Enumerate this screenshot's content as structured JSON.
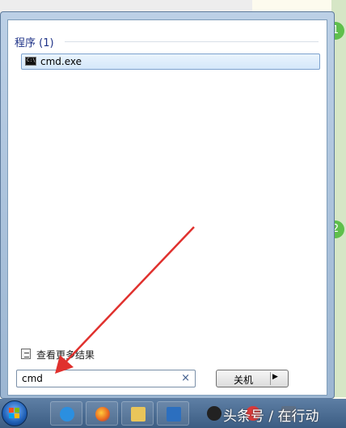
{
  "start_menu": {
    "group": {
      "title": "程序 (1)"
    },
    "results": [
      {
        "label": "cmd.exe"
      }
    ],
    "see_more_label": "查看更多结果",
    "search": {
      "value": "cmd"
    },
    "clear_glyph": "×",
    "shutdown": {
      "label": "关机",
      "arrow_glyph": "▶"
    }
  },
  "steps": [
    "1",
    "2"
  ],
  "icons": {
    "cmd": "command-prompt-icon",
    "see_more": "search-results-icon",
    "clear": "close-icon",
    "start": "windows-start-icon"
  },
  "taskbar": {
    "apps": [
      "internet-explorer",
      "firefox",
      "file-explorer",
      "rstudio"
    ],
    "watermark": "头条号 / 在行动"
  },
  "colors": {
    "accent": "#1e3287",
    "step_badge": "#5fbf4c",
    "arrow": "#e0312e",
    "selection": "#d4e7fa"
  }
}
